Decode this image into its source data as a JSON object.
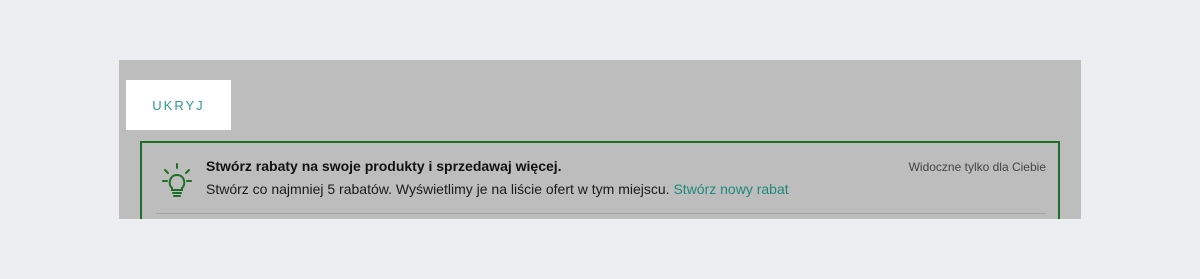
{
  "hide_button": {
    "label": "UKRYJ"
  },
  "banner": {
    "icon": "lightbulb-icon",
    "title": "Stwórz rabaty na swoje produkty i sprzedawaj więcej.",
    "description": "Stwórz co najmniej 5 rabatów. Wyświetlimy je na liście ofert w tym miejscu.",
    "link_label": "Stwórz nowy rabat",
    "visibility_note": "Widoczne tylko dla Ciebie"
  },
  "colors": {
    "accent": "#2e9a8b",
    "link": "#1d8a7a",
    "banner_border": "#1d6f26",
    "overlay": "#bdbdbd",
    "page_background": "#eceef1"
  }
}
